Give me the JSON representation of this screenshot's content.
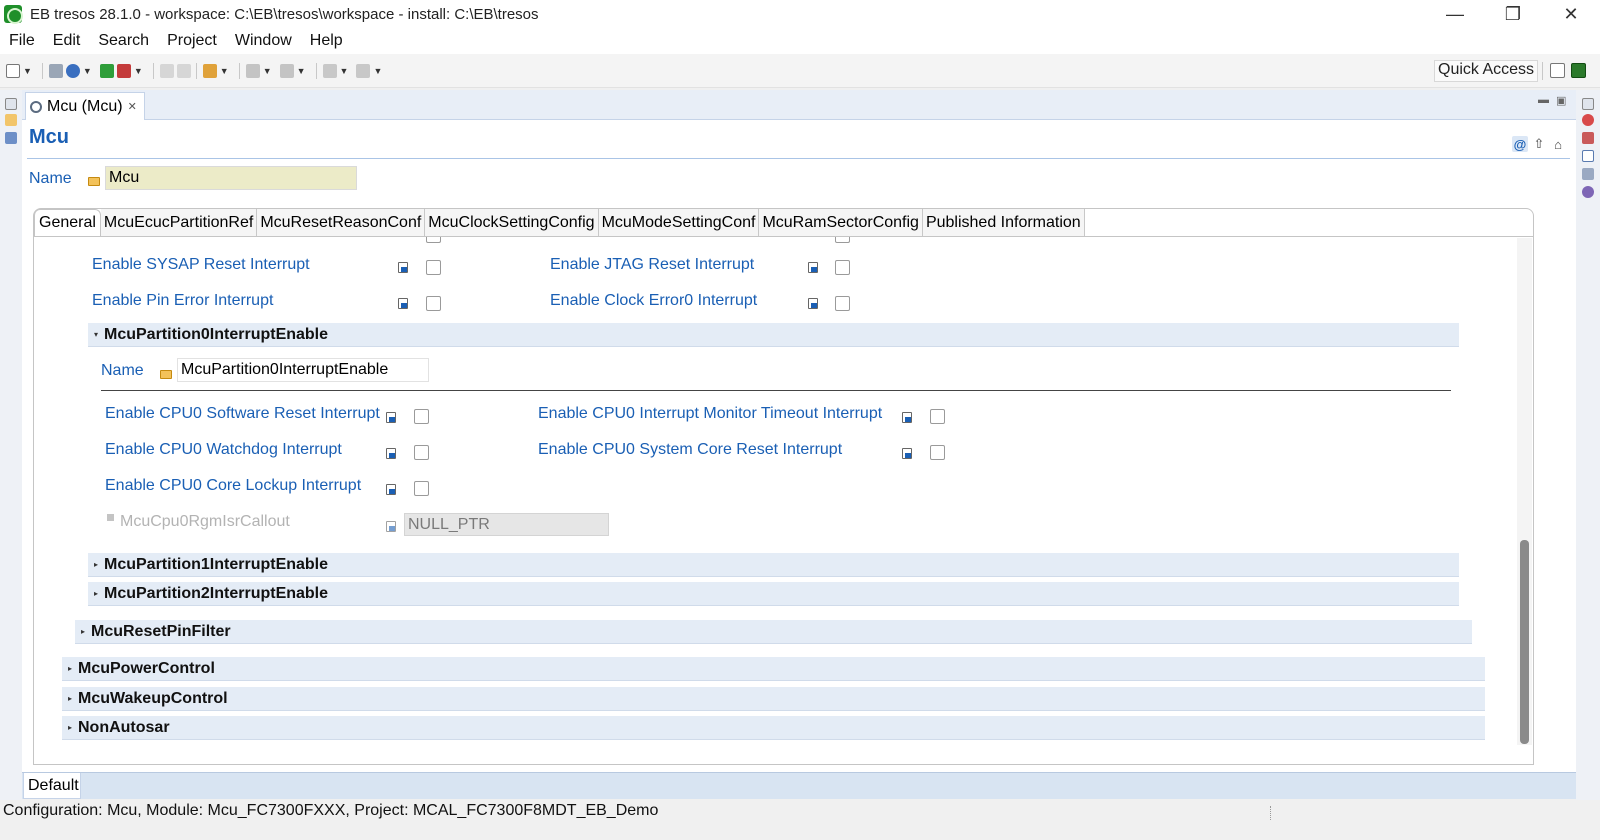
{
  "window": {
    "title": "EB tresos 28.1.0 - workspace: C:\\EB\\tresos\\workspace - install: C:\\EB\\tresos",
    "minimize": "—",
    "restore": "❐",
    "close": "✕"
  },
  "menu": [
    "File",
    "Edit",
    "Search",
    "Project",
    "Window",
    "Help"
  ],
  "toolbar": {
    "quick_access": "Quick Access"
  },
  "editor": {
    "tab_label": "Mcu (Mcu)",
    "tab_close": "✕",
    "title": "Mcu",
    "name_label": "Name",
    "name_value": "Mcu",
    "inner_tabs": [
      "General",
      "McuEcucPartitionRef",
      "McuResetReasonConf",
      "McuClockSettingConfig",
      "McuModeSettingConf",
      "McuRamSectorConfig",
      "Published Information"
    ],
    "top_fields": [
      {
        "left": "Enable SYSAP Reset Interrupt",
        "right": "Enable JTAG Reset Interrupt"
      },
      {
        "left": "Enable Pin Error Interrupt",
        "right": "Enable Clock Error0 Interrupt"
      }
    ],
    "partition0": {
      "title": "McuPartition0InterruptEnable",
      "name_label": "Name",
      "name_value": "McuPartition0InterruptEnable",
      "rows": [
        {
          "left": "Enable CPU0 Software Reset Interrupt",
          "right": "Enable CPU0 Interrupt Monitor Timeout Interrupt"
        },
        {
          "left": "Enable CPU0 Watchdog Interrupt",
          "right": "Enable CPU0 System Core Reset Interrupt"
        },
        {
          "left": "Enable CPU0 Core Lockup Interrupt",
          "right": ""
        }
      ],
      "callout_label": "McuCpu0RgmIsrCallout",
      "callout_value": "NULL_PTR"
    },
    "sections_level2": [
      "McuPartition1InterruptEnable",
      "McuPartition2InterruptEnable"
    ],
    "section_level1": "McuResetPinFilter",
    "sections_level0": [
      "McuPowerControl",
      "McuWakeupControl",
      "NonAutosar"
    ],
    "bottom_tab": "Default"
  },
  "status": {
    "text": "Configuration: Mcu, Module: Mcu_FC7300FXXX, Project: MCAL_FC7300F8MDT_EB_Demo"
  },
  "icons": {
    "expanded": "▾",
    "collapsed": "▸"
  },
  "colors": {
    "label_blue": "#1a5fb4",
    "section_bg": "#e4ecf6",
    "name_field_bg": "#ecebc8"
  }
}
